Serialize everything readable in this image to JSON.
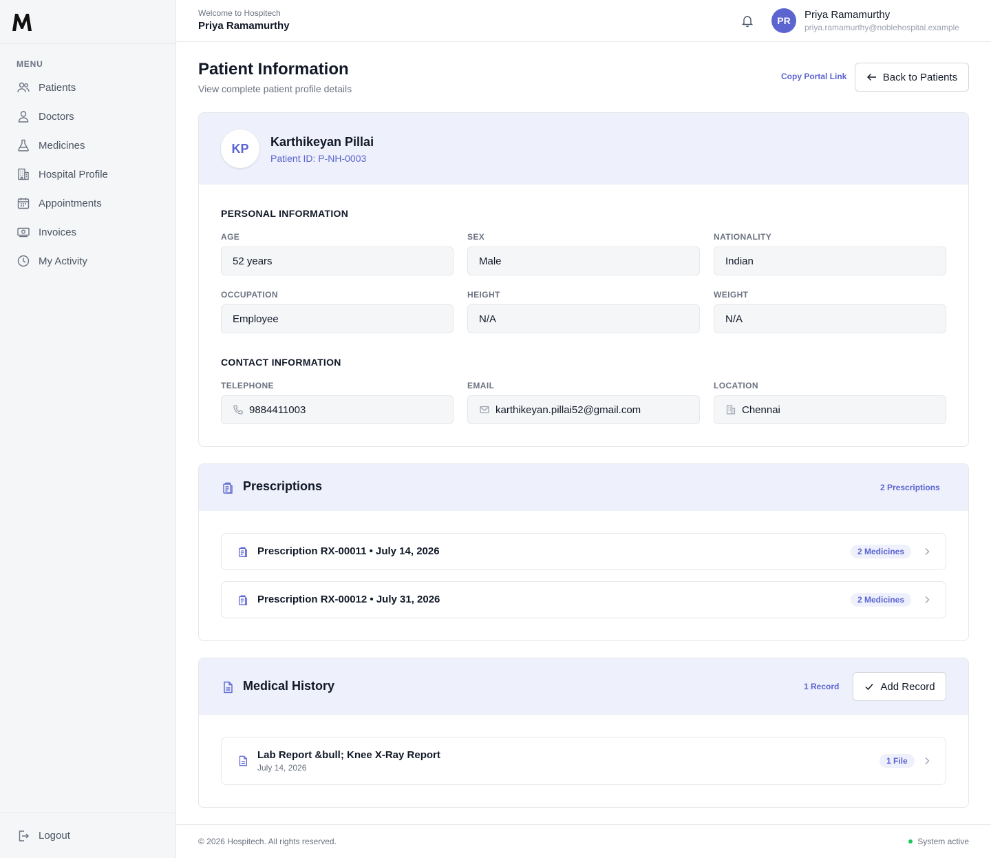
{
  "app": {
    "logo_letter": "M"
  },
  "sidebar": {
    "menu_heading": "MENU",
    "items": [
      {
        "label": "Patients",
        "icon": "users-icon"
      },
      {
        "label": "Doctors",
        "icon": "user-icon"
      },
      {
        "label": "Medicines",
        "icon": "flask-icon"
      },
      {
        "label": "Hospital Profile",
        "icon": "building-icon"
      },
      {
        "label": "Appointments",
        "icon": "calendar-icon"
      },
      {
        "label": "Invoices",
        "icon": "money-icon"
      },
      {
        "label": "My Activity",
        "icon": "clock-icon"
      }
    ],
    "logout_label": "Logout"
  },
  "header": {
    "welcome": "Welcome to Hospitech",
    "welcome_name": "Priya Ramamurthy",
    "user_initials": "PR",
    "user_name": "Priya Ramamurthy",
    "user_email": "priya.ramamurthy@noblehospital.example"
  },
  "page": {
    "title": "Patient Information",
    "subtitle": "View complete patient profile details",
    "copy_link": "Copy Portal Link",
    "back_label": "Back to Patients"
  },
  "patient": {
    "initials": "KP",
    "name": "Karthikeyan Pillai",
    "id_label": "Patient ID: P-NH-0003"
  },
  "personal": {
    "heading": "PERSONAL INFORMATION",
    "fields": [
      {
        "label": "AGE",
        "value": "52 years"
      },
      {
        "label": "SEX",
        "value": "Male"
      },
      {
        "label": "NATIONALITY",
        "value": "Indian"
      },
      {
        "label": "OCCUPATION",
        "value": "Employee"
      },
      {
        "label": "HEIGHT",
        "value": "N/A"
      },
      {
        "label": "WEIGHT",
        "value": "N/A"
      }
    ]
  },
  "contact": {
    "heading": "CONTACT INFORMATION",
    "fields": [
      {
        "label": "TELEPHONE",
        "value": "9884411003",
        "icon": "phone-icon"
      },
      {
        "label": "EMAIL",
        "value": "karthikeyan.pillai52@gmail.com",
        "icon": "mail-icon"
      },
      {
        "label": "LOCATION",
        "value": "Chennai",
        "icon": "building-icon"
      }
    ]
  },
  "prescriptions": {
    "title": "Prescriptions",
    "count": "2 Prescriptions",
    "items": [
      {
        "title": "Prescription RX-00011 • July 14, 2026",
        "badge": "2 Medicines"
      },
      {
        "title": "Prescription RX-00012 • July 31, 2026",
        "badge": "2 Medicines"
      }
    ]
  },
  "history": {
    "title": "Medical History",
    "count": "1 Record",
    "add_label": "Add Record",
    "items": [
      {
        "title": "Lab Report &bull; Knee X-Ray Report",
        "date": "July 14, 2026",
        "badge": "1 File"
      }
    ]
  },
  "footer": {
    "copyright": "© 2026 Hospitech. All rights reserved.",
    "status": "System active"
  },
  "colors": {
    "accent": "#5b64d1",
    "accent_light": "#eef0fb",
    "status_green": "#22c55e"
  }
}
